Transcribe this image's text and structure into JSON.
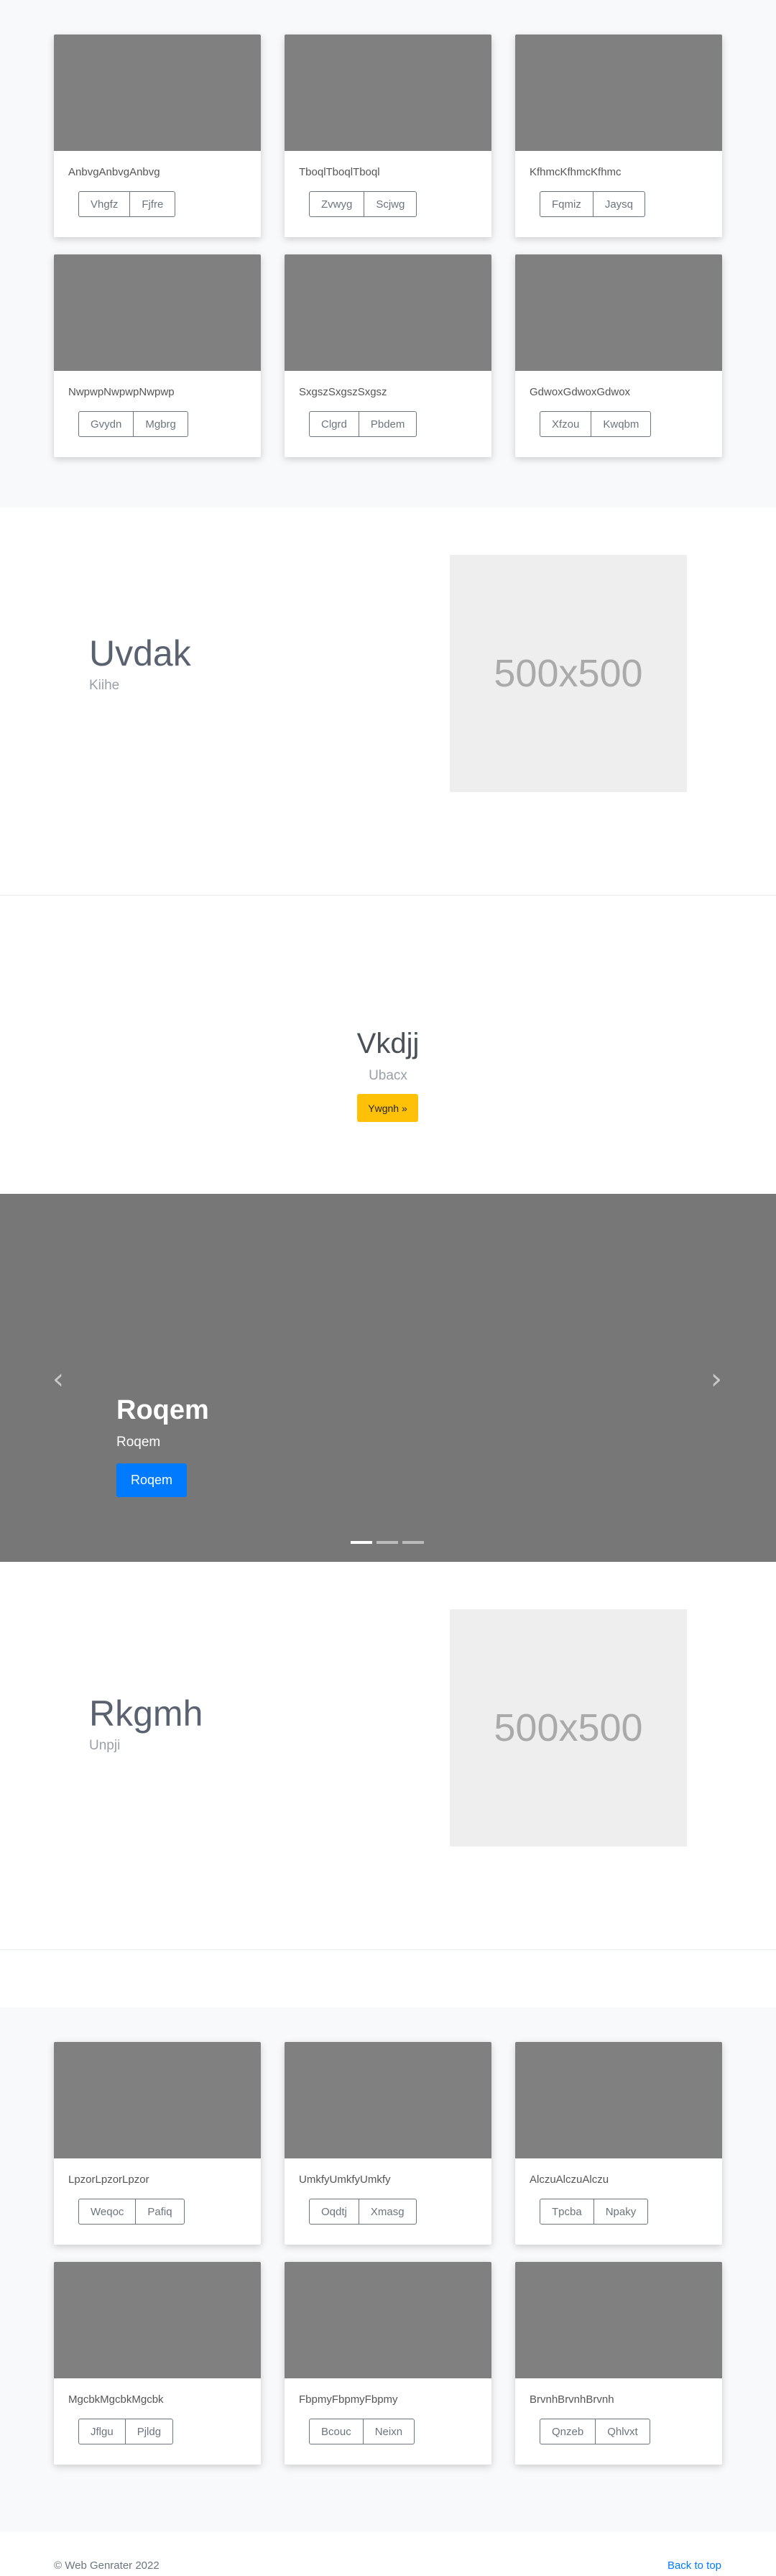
{
  "album_top": {
    "cards": [
      {
        "text": "AnbvgAnbvgAnbvg",
        "btn1": "Vhgfz",
        "btn2": "Fjfre"
      },
      {
        "text": "TboqlTboqlTboql",
        "btn1": "Zvwyg",
        "btn2": "Scjwg"
      },
      {
        "text": "KfhmcKfhmcKfhmc",
        "btn1": "Fqmiz",
        "btn2": "Jaysq"
      },
      {
        "text": "NwpwpNwpwpNwpwp",
        "btn1": "Gvydn",
        "btn2": "Mgbrg"
      },
      {
        "text": "SxgszSxgszSxgsz",
        "btn1": "Clgrd",
        "btn2": "Pbdem"
      },
      {
        "text": "GdwoxGdwoxGdwox",
        "btn1": "Xfzou",
        "btn2": "Kwqbm"
      }
    ]
  },
  "featurette1": {
    "heading": "Uvdak",
    "sub": "Kiihe",
    "img_label": "500x500"
  },
  "cta": {
    "heading": "Vkdjj",
    "sub": "Ubacx",
    "button": "Ywgnh »"
  },
  "carousel": {
    "prev": "‹",
    "next": "›",
    "title": "Roqem",
    "text": "Roqem",
    "button": "Roqem",
    "slide_count": 3,
    "active_index": 0
  },
  "featurette2": {
    "heading": "Rkgmh",
    "sub": "Unpji",
    "img_label": "500x500"
  },
  "album_bottom": {
    "cards": [
      {
        "text": "LpzorLpzorLpzor",
        "btn1": "Weqoc",
        "btn2": "Pafiq"
      },
      {
        "text": "UmkfyUmkfyUmkfy",
        "btn1": "Oqdtj",
        "btn2": "Xmasg"
      },
      {
        "text": "AlczuAlczuAlczu",
        "btn1": "Tpcba",
        "btn2": "Npaky"
      },
      {
        "text": "MgcbkMgcbkMgcbk",
        "btn1": "Jflgu",
        "btn2": "Pjldg"
      },
      {
        "text": "FbpmyFbpmyFbpmy",
        "btn1": "Bcouc",
        "btn2": "Neixn"
      },
      {
        "text": "BrvnhBrvnhBrvnh",
        "btn1": "Qnzeb",
        "btn2": "Qhlvxt"
      }
    ]
  },
  "footer": {
    "copyright": "© Web Genrater 2022",
    "back_to_top": "Back to top"
  }
}
